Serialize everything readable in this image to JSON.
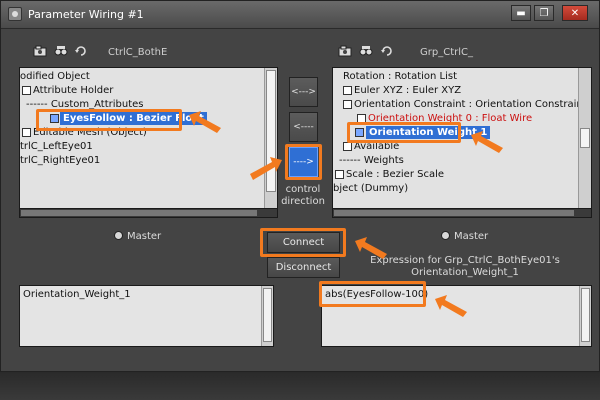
{
  "window": {
    "title": "Parameter Wiring #1",
    "minimize_glyph": "▬",
    "restore_glyph": "❐",
    "close_glyph": "✕"
  },
  "left_panel": {
    "title": "CtrlC_BothE",
    "tree": [
      {
        "text": "odified Object"
      },
      {
        "text": "Attribute Holder"
      },
      {
        "text": "------ Custom_Attributes"
      },
      {
        "text": "EyesFollow : Bezier Float",
        "selected": true
      },
      {
        "text": "Editable Mesh (Object)"
      },
      {
        "text": "trlC_LeftEye01"
      },
      {
        "text": "trlC_RightEye01"
      }
    ],
    "master_label": "Master"
  },
  "right_panel": {
    "title": "Grp_CtrlC_",
    "tree": [
      {
        "text": "Rotation : Rotation List"
      },
      {
        "text": "Euler XYZ : Euler XYZ"
      },
      {
        "text": "Orientation Constraint : Orientation Constraint"
      },
      {
        "text": "Orientation Weight 0 : Float Wire",
        "red": true
      },
      {
        "text": "Orientation Weight 1",
        "selected": true
      },
      {
        "text": "Available"
      },
      {
        "text": "------ Weights"
      },
      {
        "text": "Scale : Bezier Scale"
      },
      {
        "text": "bject (Dummy)"
      }
    ],
    "master_label": "Master"
  },
  "center": {
    "arrow_right_label": "<--->",
    "arrow_left_label": "<----",
    "arrow_active_label": "---->",
    "control_direction_label_1": "control",
    "control_direction_label_2": "direction",
    "connect_label": "Connect",
    "disconnect_label": "Disconnect"
  },
  "expression": {
    "caption_line1": "Expression for Grp_CtrlC_BothEye01's",
    "caption_line2": "Orientation_Weight_1",
    "left_value": "Orientation_Weight_1",
    "right_value": "abs(EyesFollow-100)"
  },
  "colors": {
    "highlight": "#f27a1f",
    "selection": "#2f6fd4"
  }
}
